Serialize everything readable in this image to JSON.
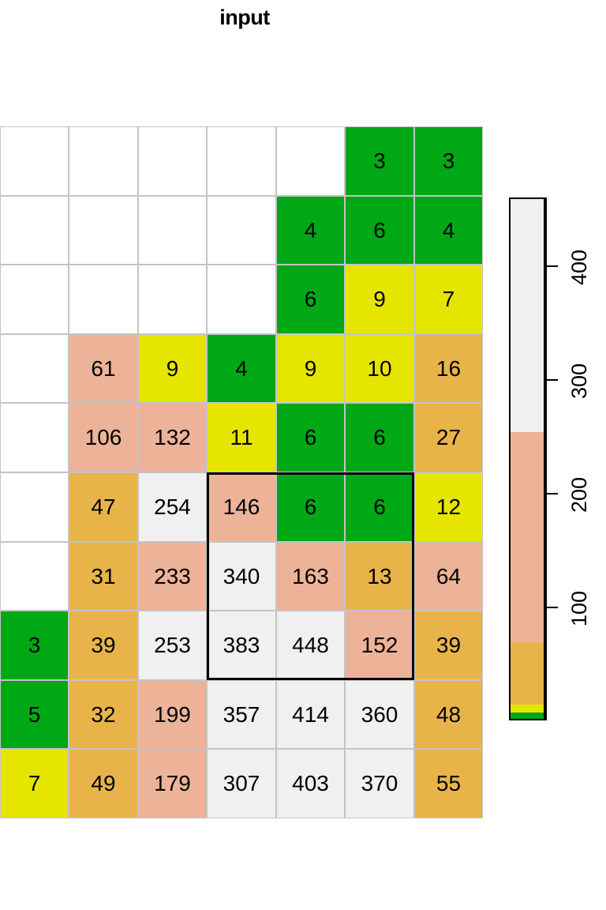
{
  "title": "input",
  "chart_data": {
    "type": "heatmap",
    "title": "input",
    "xlabel": "",
    "ylabel": "",
    "n_rows": 10,
    "n_cols": 7,
    "grid": [
      [
        null,
        null,
        null,
        null,
        null,
        3,
        3
      ],
      [
        null,
        null,
        null,
        null,
        4,
        6,
        4
      ],
      [
        null,
        null,
        null,
        null,
        6,
        9,
        7
      ],
      [
        null,
        61,
        9,
        4,
        9,
        10,
        16
      ],
      [
        null,
        106,
        132,
        11,
        6,
        6,
        27
      ],
      [
        null,
        47,
        254,
        146,
        6,
        6,
        12
      ],
      [
        null,
        31,
        233,
        340,
        163,
        13,
        64
      ],
      [
        3,
        39,
        253,
        383,
        448,
        152,
        39
      ],
      [
        5,
        32,
        199,
        357,
        414,
        360,
        48
      ],
      [
        7,
        49,
        179,
        307,
        403,
        370,
        55
      ]
    ],
    "cell_colors": [
      [
        "empty",
        "empty",
        "empty",
        "empty",
        "empty",
        "green",
        "green"
      ],
      [
        "empty",
        "empty",
        "empty",
        "empty",
        "green",
        "green",
        "green"
      ],
      [
        "empty",
        "empty",
        "empty",
        "empty",
        "green",
        "yellow",
        "yellow"
      ],
      [
        "empty",
        "salmon",
        "yellow",
        "green",
        "yellow",
        "yellow",
        "orange"
      ],
      [
        "empty",
        "salmon",
        "salmon",
        "yellow",
        "green",
        "green",
        "orange"
      ],
      [
        "empty",
        "orange",
        "offwhite",
        "salmon",
        "green",
        "green",
        "yellow"
      ],
      [
        "empty",
        "orange",
        "salmon",
        "offwhite",
        "salmon",
        "orange",
        "salmon"
      ],
      [
        "green",
        "orange",
        "offwhite",
        "offwhite",
        "offwhite",
        "salmon",
        "orange"
      ],
      [
        "green",
        "orange",
        "salmon",
        "offwhite",
        "offwhite",
        "offwhite",
        "orange"
      ],
      [
        "yellow",
        "orange",
        "salmon",
        "offwhite",
        "offwhite",
        "offwhite",
        "orange"
      ]
    ],
    "highlight": {
      "row_start": 5,
      "row_end": 7,
      "col_start": 3,
      "col_end": 5,
      "border_color": "#000000",
      "values": [
        [
          146,
          6,
          6
        ],
        [
          340,
          163,
          13
        ],
        [
          383,
          448,
          152
        ]
      ]
    },
    "palette": {
      "green": "#00a816",
      "yellow": "#e5e500",
      "orange": "#e8b44a",
      "salmon": "#edb399",
      "offwhite": "#f0f0f0",
      "empty": "#ffffff",
      "gridline": "#c4c4c4"
    },
    "legend": {
      "orientation": "vertical",
      "ticks": [
        100,
        200,
        300,
        400
      ],
      "tick_labels": [
        "100",
        "200",
        "300",
        "400"
      ],
      "range": [
        0,
        460
      ],
      "bands": [
        {
          "color": "#00a816",
          "from": 0,
          "to": 8
        },
        {
          "color": "#e5e500",
          "from": 8,
          "to": 15
        },
        {
          "color": "#e8b44a",
          "from": 15,
          "to": 70
        },
        {
          "color": "#edb399",
          "from": 70,
          "to": 255
        },
        {
          "color": "#f0f0f0",
          "from": 255,
          "to": 460
        }
      ]
    }
  }
}
